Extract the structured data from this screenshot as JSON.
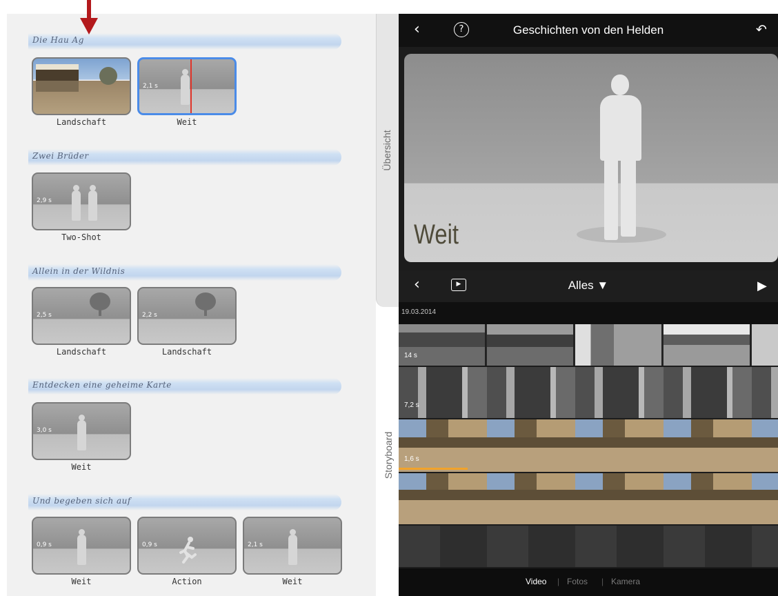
{
  "storyboard": {
    "sections": [
      {
        "title": "Die Hau    Ag",
        "shots": [
          {
            "label": "Landschaft",
            "duration": ""
          },
          {
            "label": "Weit",
            "duration": "2,1 s"
          }
        ]
      },
      {
        "title": "Zwei Brüder",
        "shots": [
          {
            "label": "Two-Shot",
            "duration": "2,9 s"
          }
        ]
      },
      {
        "title": "Allein in der Wildnis",
        "shots": [
          {
            "label": "Landschaft",
            "duration": "2,5 s"
          },
          {
            "label": "Landschaft",
            "duration": "2,2 s"
          }
        ]
      },
      {
        "title": "Entdecken eine geheime Karte",
        "shots": [
          {
            "label": "Weit",
            "duration": "3,0 s"
          }
        ]
      },
      {
        "title": "Und begeben sich auf",
        "shots": [
          {
            "label": "Weit",
            "duration": "0,9 s"
          },
          {
            "label": "Action",
            "duration": "0,9 s"
          },
          {
            "label": "Weit",
            "duration": "2,1 s"
          }
        ]
      }
    ]
  },
  "side_tabs": {
    "overview": "Übersicht",
    "storyboard": "Storyboard"
  },
  "topbar": {
    "title": "Geschichten von den Helden",
    "back_icon": "chevron-left-icon",
    "help_icon": "question-circle-icon",
    "undo_icon": "undo-icon"
  },
  "preview": {
    "label": "Weit"
  },
  "media_bar": {
    "filter": "Alles ▼",
    "back_icon": "chevron-left-icon",
    "clip_icon": "play-box-icon",
    "play_icon": "play-icon"
  },
  "media": {
    "date": "19.03.2014",
    "clips": [
      {
        "duration": "14 s"
      },
      {
        "duration": "7,2 s"
      },
      {
        "duration": "1,6 s"
      },
      {
        "duration": ""
      },
      {
        "duration": ""
      }
    ]
  },
  "bottom_tabs": {
    "video": "Video",
    "photos": "Fotos",
    "camera": "Kamera",
    "sep": "|"
  },
  "colors": {
    "accent": "#4a8be8",
    "playhead": "#e0352a",
    "banner": "#c2d6ee",
    "arrow": "#b3191c"
  }
}
